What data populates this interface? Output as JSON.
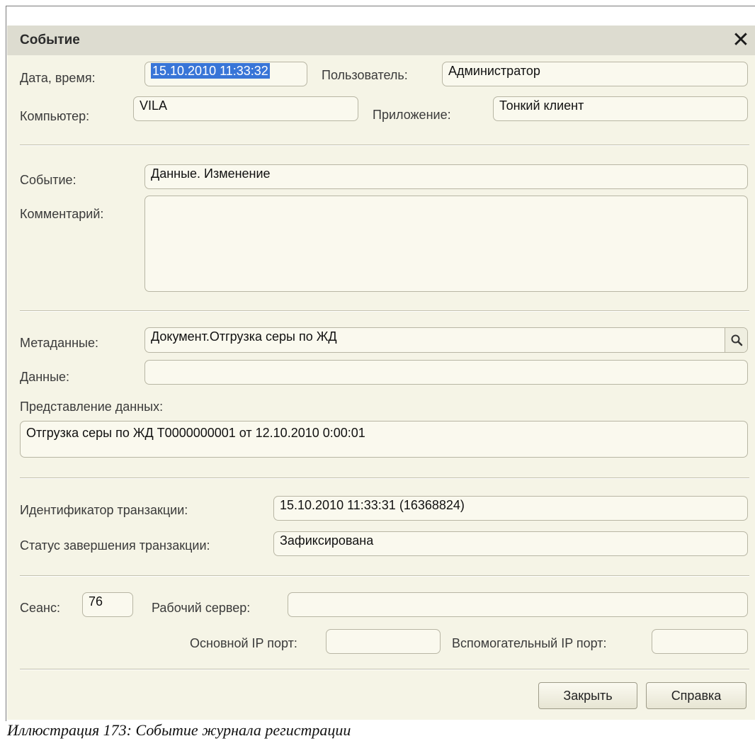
{
  "dialog": {
    "title": "Событие",
    "close_label": "✕"
  },
  "fields": {
    "datetime_label": "Дата, время:",
    "datetime_value": "15.10.2010 11:33:32",
    "user_label": "Пользователь:",
    "user_value": "Администратор",
    "computer_label": "Компьютер:",
    "computer_value": "VILA",
    "app_label": "Приложение:",
    "app_value": "Тонкий клиент",
    "event_label": "Событие:",
    "event_value": "Данные. Изменение",
    "comment_label": "Комментарий:",
    "comment_value": "",
    "metadata_label": "Метаданные:",
    "metadata_value": "Документ.Отгрузка серы по ЖД",
    "data_label": "Данные:",
    "data_value": "",
    "data_repr_label": "Представление данных:",
    "data_repr_value": "Отгрузка серы по ЖД Т0000000001 от 12.10.2010 0:00:01",
    "transaction_id_label": "Идентификатор транзакции:",
    "transaction_id_value": "15.10.2010 11:33:31 (16368824)",
    "transaction_status_label": "Статус завершения транзакции:",
    "transaction_status_value": "Зафиксирована",
    "session_label": "Сеанс:",
    "session_value": "76",
    "work_server_label": "Рабочий сервер:",
    "work_server_value": "",
    "main_ip_port_label": "Основной IP порт:",
    "main_ip_port_value": "",
    "aux_ip_port_label": "Вспомогательный IP порт:",
    "aux_ip_port_value": ""
  },
  "buttons": {
    "close_label": "Закрыть",
    "help_label": "Справка"
  },
  "caption": "Иллюстрация 173: Событие журнала регистрации",
  "icons": {
    "metadata_search": "search-icon"
  }
}
